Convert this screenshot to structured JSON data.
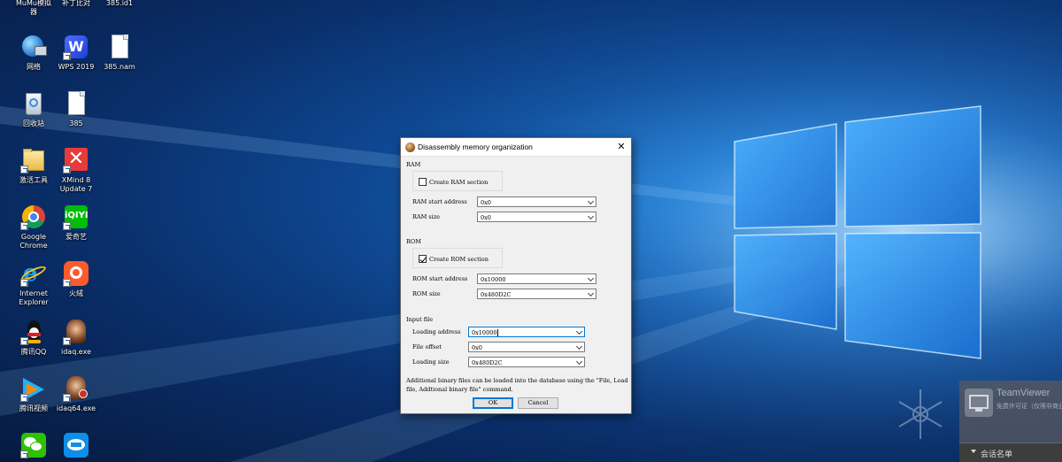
{
  "desktop": {
    "icons": [
      {
        "name": "MuMu模拟器",
        "label": "MuMu模拟\n器"
      },
      {
        "label": "补丁比对"
      },
      {
        "label": "385.id1"
      },
      {
        "label": "网络"
      },
      {
        "label": "WPS 2019"
      },
      {
        "label": "385.nam"
      },
      {
        "label": "回收站"
      },
      {
        "label": "385"
      },
      {
        "label": "激活工具"
      },
      {
        "label": "XMind 8 Update 7"
      },
      {
        "label": "Google Chrome"
      },
      {
        "label": "爱奇艺"
      },
      {
        "label": "Internet Explorer"
      },
      {
        "label": "火绒"
      },
      {
        "label": "腾讯QQ"
      },
      {
        "label": "idaq.exe"
      },
      {
        "label": "腾讯视频"
      },
      {
        "label": "idaq64.exe"
      },
      {
        "label": ""
      },
      {
        "label": ""
      }
    ]
  },
  "dialog": {
    "title": "Disassembly memory organization",
    "close": "✕",
    "ram": {
      "section_label": "RAM",
      "create_label": "Create RAM section",
      "create_checked": false,
      "start_label": "RAM start address",
      "start_value": "0x0",
      "size_label": "RAM size",
      "size_value": "0x0"
    },
    "rom": {
      "section_label": "ROM",
      "create_label": "Create ROM section",
      "create_checked": true,
      "start_label": "ROM start address",
      "start_value": "0x10000",
      "size_label": "ROM size",
      "size_value": "0x480D2C"
    },
    "input_file": {
      "section_label": "Input file",
      "loading_address_label": "Loading address",
      "loading_address_value": "0x10000",
      "file_offset_label": "File offset",
      "file_offset_value": "0x0",
      "loading_size_label": "Loading size",
      "loading_size_value": "0x480D2C"
    },
    "note": "Additional binary files can be loaded into the database using the \"File, Load file, Addtional binary file\" command.",
    "ok_label": "OK",
    "cancel_label": "Cancel"
  },
  "teamviewer": {
    "name": "TeamViewer",
    "subtitle": "免费许可证（仅限非商业用途）",
    "session_list_label": "会话名单"
  },
  "colors": {
    "accent": "#0078d7",
    "wallpaper_blue": "#1f7fd6"
  }
}
